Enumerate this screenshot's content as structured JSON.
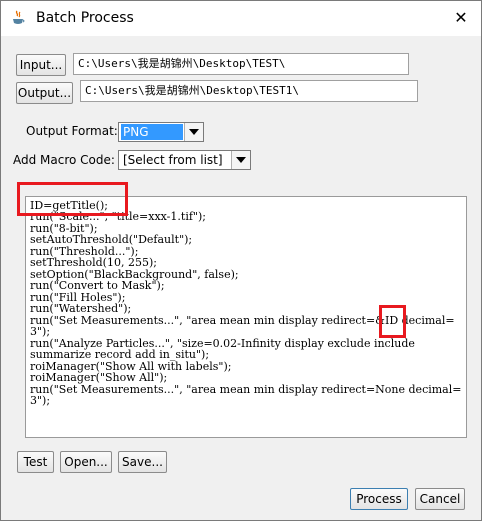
{
  "window": {
    "title": "Batch Process",
    "close_glyph": "✕"
  },
  "icons": {
    "app": "java-cup-icon",
    "close": "close-icon",
    "dropdown": "chevron-down-icon"
  },
  "input": {
    "button_label": "Input...",
    "path": "C:\\Users\\我是胡锦州\\Desktop\\TEST\\"
  },
  "output": {
    "button_label": "Output...",
    "path": "C:\\Users\\我是胡锦州\\Desktop\\TEST1\\"
  },
  "output_format": {
    "label": "Output Format:",
    "value": "PNG"
  },
  "macro_code": {
    "label": "Add Macro Code:",
    "value": "[Select from list]"
  },
  "code_lines": [
    "ID=getTitle();",
    "run(\"Scale...\", \"title=xxx-1.tif\");",
    "run(\"8-bit\");",
    "setAutoThreshold(\"Default\");",
    "run(\"Threshold...\");",
    "setThreshold(10, 255);",
    "setOption(\"BlackBackground\", false);",
    "run(\"Convert to Mask\");",
    "run(\"Fill Holes\");",
    "run(\"Watershed\");",
    "run(\"Set Measurements...\", \"area mean min display redirect=&ID decimal=",
    "3\");",
    "run(\"Analyze Particles...\", \"size=0.02-Infinity display exclude include",
    "summarize record add in_situ\");",
    "roiManager(\"Show All with labels\");",
    "roiManager(\"Show All\");",
    "run(\"Set Measurements...\", \"area mean min display redirect=None decimal=",
    "3\");"
  ],
  "bottom_buttons": {
    "test": "Test",
    "open": "Open...",
    "save": "Save..."
  },
  "dialog_buttons": {
    "process": "Process",
    "cancel": "Cancel"
  },
  "colors": {
    "highlight": "#e8191f",
    "selection": "#3399ff"
  }
}
